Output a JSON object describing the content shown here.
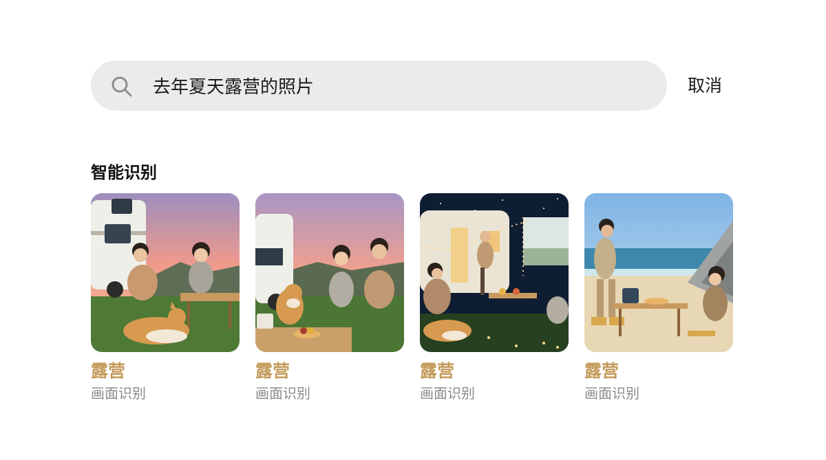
{
  "search": {
    "query": "去年夏天露营的照片",
    "cancel_label": "取消"
  },
  "section": {
    "title": "智能识别"
  },
  "results": [
    {
      "title": "露营",
      "subtitle": "画面识别",
      "scene": "sunset-rv-left"
    },
    {
      "title": "露营",
      "subtitle": "画面识别",
      "scene": "sunset-rv-picnic"
    },
    {
      "title": "露营",
      "subtitle": "画面识别",
      "scene": "night-caravan-lights"
    },
    {
      "title": "露营",
      "subtitle": "画面识别",
      "scene": "beach-tent"
    }
  ],
  "colors": {
    "accent": "#c49a5b",
    "search_bg": "#ebebeb",
    "subtitle": "#8a8a8a"
  }
}
